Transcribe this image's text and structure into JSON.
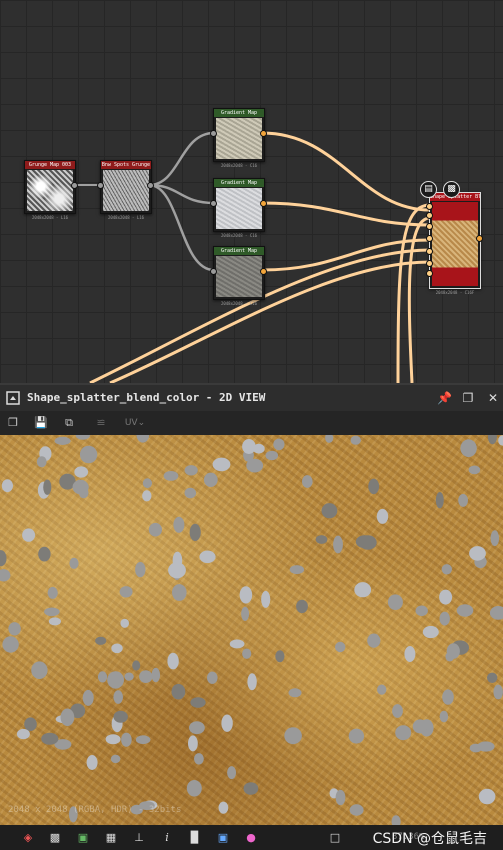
{
  "graph": {
    "nodes": [
      {
        "id": "grunge",
        "title": "Grunge Map 003",
        "resolution": "2048x2048 - L16",
        "header_color": "#8f1b1b"
      },
      {
        "id": "bnw",
        "title": "Bnw Spots Grunge",
        "resolution": "2048x2048 - L16",
        "header_color": "#8f1b1b"
      },
      {
        "id": "grad1",
        "title": "Gradient Map",
        "resolution": "2048x2048 - C16",
        "header_color": "#2f5a28"
      },
      {
        "id": "grad2",
        "title": "Gradient Map",
        "resolution": "2048x2048 - C16",
        "header_color": "#2f5a28"
      },
      {
        "id": "grad3",
        "title": "Gradient Map",
        "resolution": "2048x2048 - C16",
        "header_color": "#2f5a28"
      },
      {
        "id": "shape",
        "title": "Shape Splatter Blend",
        "resolution": "2048x2048 - C16F",
        "header_color": "#a8141a"
      }
    ],
    "wire_gray": "#a0a0a0",
    "wire_orange": "#ffd29a"
  },
  "panel": {
    "title": "Shape_splatter_blend_color - 2D VIEW"
  },
  "toolbar": {
    "uv_label": "UV"
  },
  "viewport": {
    "status": "2048 x 2048 (RGBA, HDR) - 32bits"
  },
  "bottombar": {
    "zoom": "37.36%",
    "watermark": "CSDN @仓鼠毛吉"
  },
  "icons": [
    "layers-icon",
    "checker-icon",
    "channels-icon",
    "grid-icon",
    "tiling-icon",
    "info-icon",
    "histogram-icon",
    "display-icon",
    "color-icon",
    "fit-icon",
    "pin-icon",
    "restore-icon",
    "close-icon",
    "save-icon",
    "copy-icon",
    "export-icon",
    "snapshot-icon"
  ]
}
